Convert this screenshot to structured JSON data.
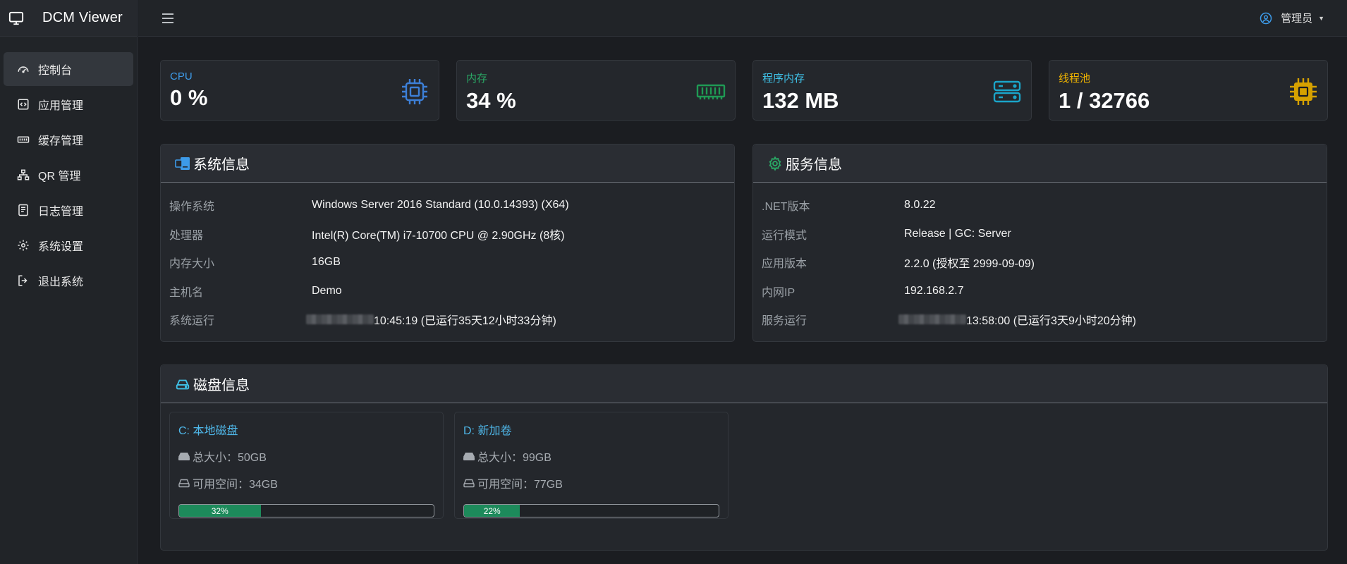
{
  "app": {
    "title": "DCM Viewer"
  },
  "sidebar": {
    "items": [
      {
        "label": "控制台",
        "icon": "gauge-icon",
        "active": true
      },
      {
        "label": "应用管理",
        "icon": "code-icon"
      },
      {
        "label": "缓存管理",
        "icon": "memory-icon"
      },
      {
        "label": "QR 管理",
        "icon": "sitemap-icon"
      },
      {
        "label": "日志管理",
        "icon": "log-icon"
      },
      {
        "label": "系统设置",
        "icon": "gear-icon"
      },
      {
        "label": "退出系统",
        "icon": "logout-icon"
      }
    ]
  },
  "topbar": {
    "user_label": "管理员"
  },
  "stats": [
    {
      "label": "CPU",
      "value": "0 %",
      "color": "#3d9be9",
      "icon": "cpu-icon"
    },
    {
      "label": "内存",
      "value": "34 %",
      "color": "#2aa865",
      "icon": "memory-icon"
    },
    {
      "label": "程序内存",
      "value": "132 MB",
      "color": "#3fc2e8",
      "icon": "server-icon"
    },
    {
      "label": "线程池",
      "value": "1 / 32766",
      "color": "#f1b500",
      "icon": "chip-icon"
    }
  ],
  "system_info": {
    "title": "系统信息",
    "rows": [
      {
        "k": "操作系统",
        "v": "Windows Server 2016 Standard (10.0.14393) (X64)"
      },
      {
        "k": "处理器",
        "v": "Intel(R) Core(TM) i7-10700 CPU @ 2.90GHz (8核)"
      },
      {
        "k": "内存大小",
        "v": "16GB"
      },
      {
        "k": "主机名",
        "v": "Demo"
      },
      {
        "k": "系统运行",
        "v": "10:45:19 (已运行35天12小时33分钟)"
      }
    ]
  },
  "service_info": {
    "title": "服务信息",
    "rows": [
      {
        "k": ".NET版本",
        "v": "8.0.22"
      },
      {
        "k": "运行模式",
        "v": "Release | GC: Server"
      },
      {
        "k": "应用版本",
        "v": "2.2.0 (授权至 2999-09-09)"
      },
      {
        "k": "内网IP",
        "v": "192.168.2.7"
      },
      {
        "k": "服务运行",
        "v": "13:58:00 (已运行3天9小时20分钟)"
      }
    ]
  },
  "disk_info": {
    "title": "磁盘信息",
    "disks": [
      {
        "name": "C: 本地磁盘",
        "total": "总大小：50GB",
        "free": "可用空间：34GB",
        "used_percent": 32,
        "used_label": "32%"
      },
      {
        "name": "D: 新加卷",
        "total": "总大小：99GB",
        "free": "可用空间：77GB",
        "used_percent": 22,
        "used_label": "22%"
      }
    ]
  },
  "colors": {
    "progress": "#1d8a5b",
    "disk_name": "#4fb8ea",
    "system_icon": "#3d9be9",
    "service_icon": "#2aa865"
  }
}
